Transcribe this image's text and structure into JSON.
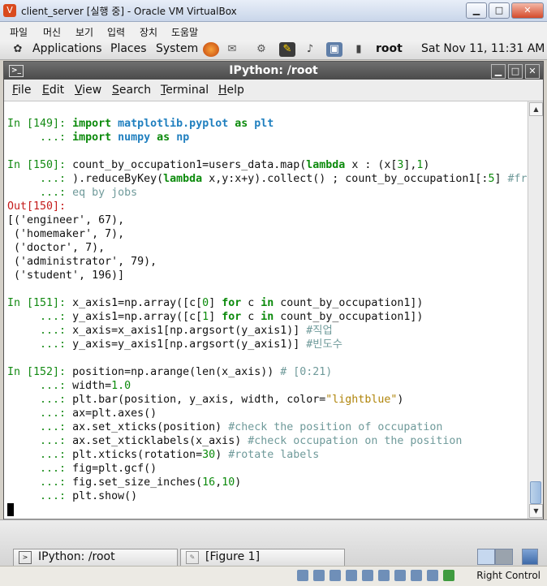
{
  "host_window": {
    "title": "client_server [실행 중] - Oracle VM VirtualBox",
    "app_icon_glyph": "V",
    "buttons": {
      "minimize": "▁",
      "maximize": "□",
      "close": "✕"
    },
    "menu": [
      "파일",
      "머신",
      "보기",
      "입력",
      "장치",
      "도움말"
    ]
  },
  "guest_top_panel": {
    "applications_label": "Applications",
    "places_label": "Places",
    "system_label": "System",
    "user_label": "root",
    "clock": "Sat Nov 11, 11:31 AM",
    "icons": [
      "gnome-foot-icon",
      "firefox-icon",
      "mail-icon",
      "network-icon",
      "screen-icon",
      "volume-icon",
      "display-icon",
      "battery-icon"
    ]
  },
  "terminal": {
    "title": "IPython: /root",
    "menu": {
      "file": {
        "u": "F",
        "rest": "ile"
      },
      "edit": {
        "u": "E",
        "rest": "dit"
      },
      "view": {
        "u": "V",
        "rest": "iew"
      },
      "search": {
        "u": "S",
        "rest": "earch"
      },
      "terminal": {
        "u": "T",
        "rest": "erminal"
      },
      "help": {
        "u": "H",
        "rest": "elp"
      }
    },
    "lines": {
      "in149_prompt": "In [149]: ",
      "in149_kw1": "import",
      "in149_mod1": "matplotlib.pyplot",
      "in149_kw2": "as",
      "in149_alias1": "plt",
      "cont_prompt": "     ...: ",
      "in149_mod2": "numpy",
      "in149_alias2": "np",
      "in150_prompt": "In [150]: ",
      "in150_a": "count_by_occupation1=users_data.map(",
      "in150_lambda": "lambda",
      "in150_b": " x : (x[",
      "in150_n3": "3",
      "in150_c": "],",
      "in150_n1": "1",
      "in150_d": ")",
      "in150_l2_a": ").reduceByKey(",
      "in150_l2_lambda": "lambda",
      "in150_l2_b": " x,y:x+y).collect() ; count_by_occupation1[:",
      "in150_l2_n5": "5",
      "in150_l2_c": "] ",
      "in150_l2_comment": "#fr",
      "in150_l3_comment": "eq by jobs",
      "out150_prompt": "Out[150]:",
      "out_1": "[('engineer', 67),",
      "out_2": " ('homemaker', 7),",
      "out_3": " ('doctor', 7),",
      "out_4": " ('administrator', 79),",
      "out_5": " ('student', 196)]",
      "in151_prompt": "In [151]: ",
      "in151_a": "x_axis1=np.array([c[",
      "in151_n0": "0",
      "in151_b": "] ",
      "in151_for": "for",
      "in151_c": " c ",
      "in151_in": "in",
      "in151_d": " count_by_occupation1])",
      "in151_l2_a": "y_axis1=np.array([c[",
      "in151_l2_n1": "1",
      "in151_l2_b": "] ",
      "in151_l2_for": "for",
      "in151_l2_c": " c ",
      "in151_l2_in": "in",
      "in151_l2_d": " count_by_occupation1])",
      "in151_l3": "x_axis=x_axis1[np.argsort(y_axis1)] ",
      "in151_l3_comment": "#직업",
      "in151_l4": "y_axis=y_axis1[np.argsort(y_axis1)] ",
      "in151_l4_comment": "#빈도수",
      "in152_prompt": "In [152]: ",
      "in152_a": "position=np.arange(len(x_axis)) ",
      "in152_a_comment": "# [0:21)",
      "in152_l2_a": "width=",
      "in152_l2_num": "1.0",
      "in152_l3_a": "plt.bar(position, y_axis, width, color=",
      "in152_l3_str": "\"lightblue\"",
      "in152_l3_b": ")",
      "in152_l4": "ax=plt.axes()",
      "in152_l5": "ax.set_xticks(position) ",
      "in152_l5_comment": "#check the position of occupation",
      "in152_l6": "ax.set_xticklabels(x_axis) ",
      "in152_l6_comment": "#check occupation on the position",
      "in152_l7_a": "plt.xticks(rotation=",
      "in152_l7_num": "30",
      "in152_l7_b": ") ",
      "in152_l7_comment": "#rotate labels",
      "in152_l8": "fig=plt.gcf()",
      "in152_l9_a": "fig.set_size_inches(",
      "in152_l9_n1": "16",
      "in152_l9_b": ",",
      "in152_l9_n2": "10",
      "in152_l9_c": ")",
      "in152_l10": "plt.show()"
    }
  },
  "guest_bottom_panel": {
    "tasks": [
      {
        "label": "IPython: /root",
        "icon": "terminal-icon"
      },
      {
        "label": "[Figure 1]",
        "icon": "figure-icon"
      }
    ]
  },
  "host_status": {
    "right_control": "Right Control"
  },
  "colors": {
    "prompt_in": "#138a13",
    "prompt_out": "#c41a1a",
    "keyword": "#0b8a0b",
    "module": "#1f7fbf",
    "string": "#b0850b",
    "comment": "#6f9a9a"
  }
}
